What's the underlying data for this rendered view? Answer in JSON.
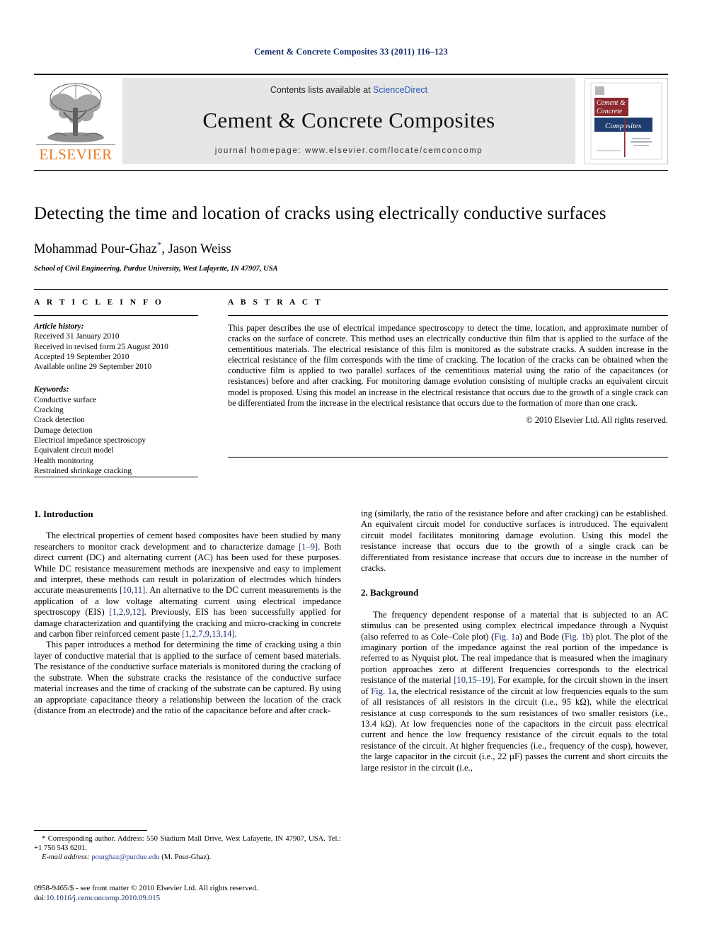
{
  "running_head": "Cement & Concrete Composites 33 (2011) 116–123",
  "masthead": {
    "contents_prefix": "Contents lists available at ",
    "sciencedirect": "ScienceDirect",
    "journal_title": "Cement & Concrete Composites",
    "homepage": "journal homepage: www.elsevier.com/locate/cemconcomp",
    "publisher": "ELSEVIER",
    "cover": {
      "line1": "Cement &",
      "line2": "Concrete",
      "line3": "Composites",
      "red": "#8c2a2f",
      "blue": "#1f3c6e"
    }
  },
  "title": "Detecting the time and location of cracks using electrically conductive surfaces",
  "authors": "Mohammad Pour-Ghaz",
  "authors_rest": ", Jason Weiss",
  "corresponding_marker": "*",
  "affiliation": "School of Civil Engineering, Purdue University, West Lafayette, IN 47907, USA",
  "article_info": {
    "heading": "A R T I C L E  I N F O",
    "history_label": "Article history:",
    "history": [
      "Received 31 January 2010",
      "Received in revised form 25 August 2010",
      "Accepted 19 September 2010",
      "Available online 29 September 2010"
    ],
    "keywords_label": "Keywords:",
    "keywords": [
      "Conductive surface",
      "Cracking",
      "Crack detection",
      "Damage detection",
      "Electrical impedance spectroscopy",
      "Equivalent circuit model",
      "Health monitoring",
      "Restrained shrinkage cracking"
    ]
  },
  "abstract": {
    "heading": "A B S T R A C T",
    "text": "This paper describes the use of electrical impedance spectroscopy to detect the time, location, and approximate number of cracks on the surface of concrete. This method uses an electrically conductive thin film that is applied to the surface of the cementitious materials. The electrical resistance of this film is monitored as the substrate cracks. A sudden increase in the electrical resistance of the film corresponds with the time of cracking. The location of the cracks can be obtained when the conductive film is applied to two parallel surfaces of the cementitious material using the ratio of the capacitances (or resistances) before and after cracking. For monitoring damage evolution consisting of multiple cracks an equivalent circuit model is proposed. Using this model an increase in the electrical resistance that occurs due to the growth of a single crack can be differentiated from the increase in the electrical resistance that occurs due to the formation of more than one crack.",
    "copyright": "© 2010 Elsevier Ltd. All rights reserved."
  },
  "body": {
    "section1_heading": "1. Introduction",
    "section1_p1_a": "The electrical properties of cement based composites have been studied by many researchers to monitor crack development and to characterize damage ",
    "section1_p1_ref1": "[1–9]",
    "section1_p1_b": ". Both direct current (DC) and alternating current (AC) has been used for these purposes. While DC resistance measurement methods are inexpensive and easy to implement and interpret, these methods can result in polarization of electrodes which hinders accurate measurements ",
    "section1_p1_ref2": "[10,11]",
    "section1_p1_c": ". An alternative to the DC current measurements is the application of a low voltage alternating current using electrical impedance spectroscopy (EIS) ",
    "section1_p1_ref3": "[1,2,9,12]",
    "section1_p1_d": ". Previously, EIS has been successfully applied for damage characterization and quantifying the cracking and micro-cracking in concrete and carbon fiber reinforced cement paste ",
    "section1_p1_ref4": "[1,2,7,9,13,14]",
    "section1_p1_e": ".",
    "section1_p2": "This paper introduces a method for determining the time of cracking using a thin layer of conductive material that is applied to the surface of cement based materials. The resistance of the conductive surface materials is monitored during the cracking of the substrate. When the substrate cracks the resistance of the conductive surface material increases and the time of cracking of the substrate can be captured. By using an appropriate capacitance theory a relationship between the location of the crack (distance from an electrode) and the ratio of the capacitance before and after crack-",
    "section1_p2_cont": "ing (similarly, the ratio of the resistance before and after cracking) can be established. An equivalent circuit model for conductive surfaces is introduced. The equivalent circuit model facilitates monitoring damage evolution. Using this model the resistance increase that occurs due to the growth of a single crack can be differentiated from resistance increase that occurs due to increase in the number of cracks.",
    "section2_heading": "2. Background",
    "section2_p1_a": "The frequency dependent response of a material that is subjected to an AC stimulus can be presented using complex electrical impedance through a Nyquist (also referred to as Cole–Cole plot) (",
    "section2_p1_fig1": "Fig. 1",
    "section2_p1_b": "a) and Bode (",
    "section2_p1_fig2": "Fig. 1",
    "section2_p1_c": "b) plot. The plot of the imaginary portion of the impedance against the real portion of the impedance is referred to as Nyquist plot. The real impedance that is measured when the imaginary portion approaches zero at different frequencies corresponds to the electrical resistance of the material ",
    "section2_p1_ref1": "[10,15–19]",
    "section2_p1_d": ". For example, for the circuit shown in the insert of ",
    "section2_p1_fig3": "Fig. 1",
    "section2_p1_e": "a, the electrical resistance of the circuit at low frequencies equals to the sum of all resistances of all resistors in the circuit (i.e., 95 kΩ), while the electrical resistance at cusp corresponds to the sum resistances of two smaller resistors (i.e., 13.4 kΩ). At low frequencies none of the capacitors in the circuit pass electrical current and hence the low frequency resistance of the circuit equals to the total resistance of the circuit. At higher frequencies (i.e., frequency of the cusp), however, the large capacitor in the circuit (i.e., 22 µF) passes the current and short circuits the large resistor in the circuit (i.e.,"
  },
  "footnotes": {
    "corresponding": "* Corresponding author. Address: 550 Stadium Mall Drive, West Lafayette, IN 47907, USA. Tel.: +1 756 543 6201.",
    "email_label": "E-mail address:",
    "email": "pourghaz@purdue.edu",
    "email_suffix": "(M. Pour-Ghaz).",
    "issn_line": "0958-9465/$ - see front matter © 2010 Elsevier Ltd. All rights reserved.",
    "doi_label": "doi:",
    "doi": "10.1016/j.cemconcomp.2010.09.015"
  }
}
